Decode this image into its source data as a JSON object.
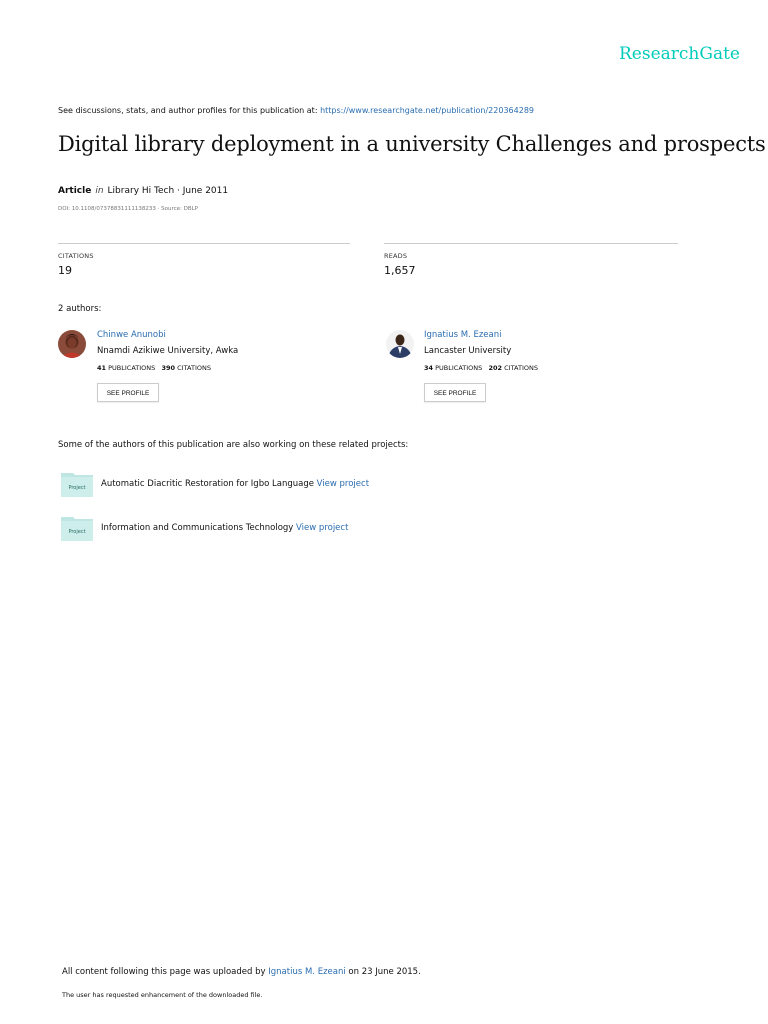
{
  "brand": "ResearchGate",
  "discussion": {
    "prefix": "See discussions, stats, and author profiles for this publication at: ",
    "url": "https://www.researchgate.net/publication/220364289"
  },
  "title": "Digital library deployment in a university Challenges and prospects",
  "meta": {
    "type": "Article",
    "in": "in",
    "journal": "Library Hi Tech · June 2011",
    "doi": "DOI: 10.1108/07378831111138233 · Source: DBLP"
  },
  "stats": {
    "citations_label": "CITATIONS",
    "citations_value": "19",
    "reads_label": "READS",
    "reads_value": "1,657"
  },
  "authors_heading": "2 authors:",
  "authors": [
    {
      "name": "Chinwe Anunobi",
      "institution": "Nnamdi Azikiwe University, Awka",
      "publications": "41",
      "publications_label": "PUBLICATIONS",
      "citations": "390",
      "citations_label": "CITATIONS",
      "button": "SEE PROFILE"
    },
    {
      "name": "Ignatius M. Ezeani",
      "institution": "Lancaster University",
      "publications": "34",
      "publications_label": "PUBLICATIONS",
      "citations": "202",
      "citations_label": "CITATIONS",
      "button": "SEE PROFILE"
    }
  ],
  "projects_heading": "Some of the authors of this publication are also working on these related projects:",
  "projects": [
    {
      "icon_label": "Project",
      "name": "Automatic Diacritic Restoration for Igbo Language",
      "link": "View project"
    },
    {
      "icon_label": "Project",
      "name": "Information and Communications Technology",
      "link": "View project"
    }
  ],
  "footer": {
    "prefix": "All content following this page was uploaded by ",
    "uploader": "Ignatius M. Ezeani",
    "suffix": " on 23 June 2015.",
    "note": "The user has requested enhancement of the downloaded file."
  },
  "colors": {
    "brand": "#00ccbb",
    "link": "#2a6db0",
    "project_icon": "#bfe6e2"
  }
}
